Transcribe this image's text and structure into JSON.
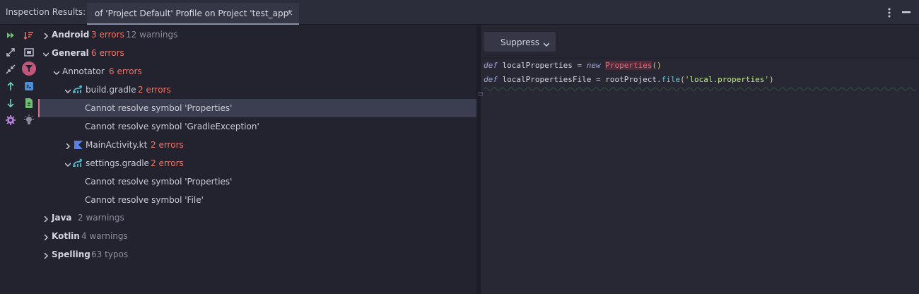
{
  "header": {
    "title": "Inspection Results:",
    "tab_label": "of 'Project Default' Profile on Project 'test_app'",
    "tab_close": "×"
  },
  "toolbar": {
    "icons": [
      "run-icon",
      "sort-icon",
      "expand-icon",
      "export-icon",
      "collapse-icon",
      "filter-icon",
      "up-icon",
      "terminal-icon",
      "down-icon",
      "file-icon",
      "settings-icon",
      "bulb-icon"
    ]
  },
  "tree": {
    "android": {
      "name": "Android",
      "errors": "3 errors",
      "warnings": "12 warnings"
    },
    "general": {
      "name": "General",
      "errors": "6 errors"
    },
    "annotator": {
      "name": "Annotator",
      "errors": "6 errors"
    },
    "build_gradle": {
      "name": "build.gradle",
      "errors": "2 errors"
    },
    "build_msg1": "Cannot resolve symbol 'Properties'",
    "build_msg2": "Cannot resolve symbol 'GradleException'",
    "main_activity": {
      "name": "MainActivity.kt",
      "errors": "2 errors"
    },
    "settings_gradle": {
      "name": "settings.gradle",
      "errors": "2 errors"
    },
    "settings_msg1": "Cannot resolve symbol 'Properties'",
    "settings_msg2": "Cannot resolve symbol 'File'",
    "java": {
      "name": "Java",
      "warnings": "2 warnings"
    },
    "kotlin": {
      "name": "Kotlin",
      "warnings": "4 warnings"
    },
    "spelling": {
      "name": "Spelling",
      "warnings": "63 typos"
    }
  },
  "editor": {
    "suppress_label": "Suppress",
    "line1": {
      "kw1": "def",
      "var": " localProperties ",
      "eq": "=",
      "kw2": " new ",
      "type": "Properties",
      "paren": "()"
    },
    "line2": {
      "kw1": "def",
      "var": " localPropertiesFile ",
      "eq": "=",
      "obj": " rootProject.",
      "fn": "file",
      "p1": "(",
      "str": "'local.properties'",
      "p2": ")"
    }
  },
  "colors": {
    "background": "#22232f",
    "error": "#e8766a",
    "selected_row": "#3b3e50",
    "selected_accent": "#e06c88",
    "filter_active": "#c4567a"
  }
}
